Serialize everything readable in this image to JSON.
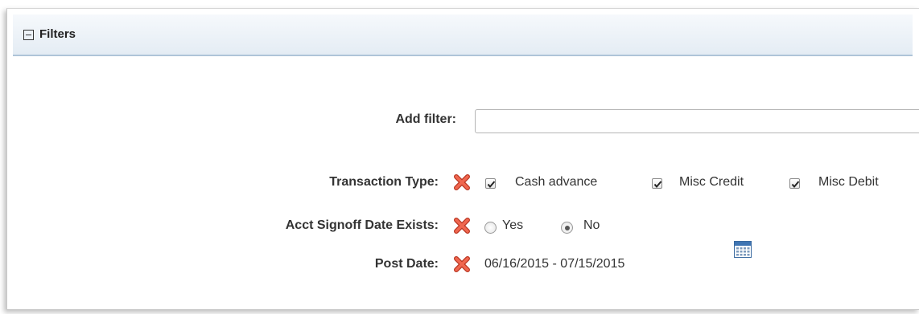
{
  "panel": {
    "title": "Filters",
    "collapse_icon": "minus-box-icon"
  },
  "add_filter": {
    "label": "Add filter:",
    "value": "",
    "placeholder": ""
  },
  "transaction_type": {
    "label": "Transaction Type:",
    "remove_icon": "red-x-icon",
    "options": [
      {
        "label": "Cash advance",
        "checked": true
      },
      {
        "label": "Misc Credit",
        "checked": true
      },
      {
        "label": "Misc Debit",
        "checked": true
      }
    ]
  },
  "acct_signoff": {
    "label": "Acct Signoff Date Exists:",
    "remove_icon": "red-x-icon",
    "options": [
      {
        "label": "Yes",
        "selected": false
      },
      {
        "label": "No",
        "selected": true
      }
    ]
  },
  "post_date": {
    "label": "Post Date:",
    "remove_icon": "red-x-icon",
    "value": "06/16/2015 - 07/15/2015",
    "calendar_icon": "calendar-icon"
  },
  "colors": {
    "header_border": "#aec4d8",
    "remove_red": "#e0452f"
  }
}
